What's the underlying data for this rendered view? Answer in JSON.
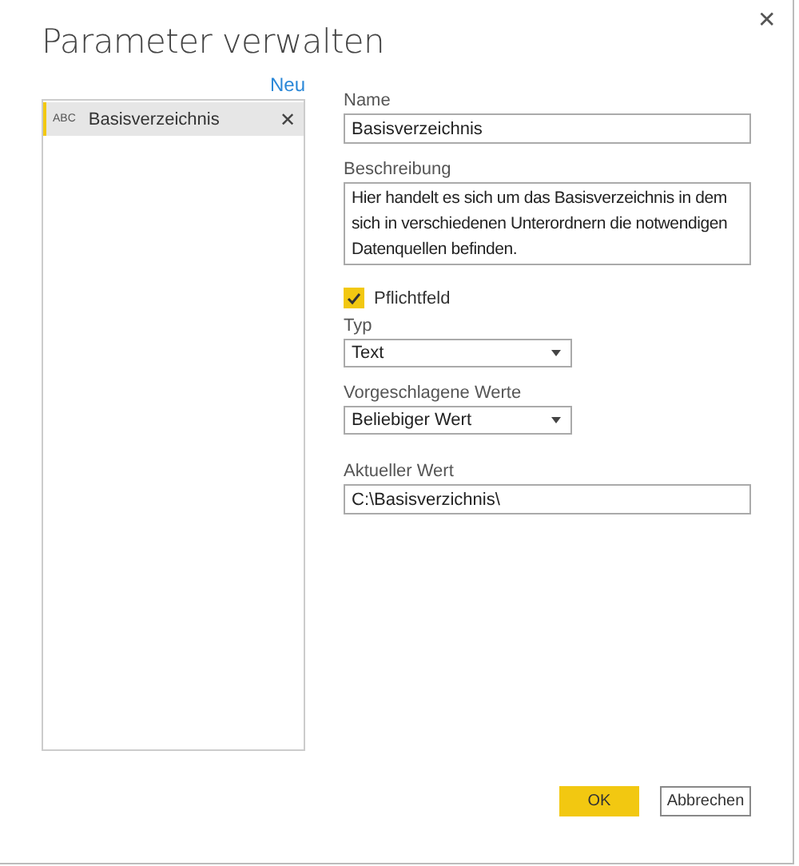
{
  "window": {
    "title": "Parameter verwalten",
    "close": "✕"
  },
  "parameters": {
    "new_link": "Neu",
    "items": [
      {
        "name": "Basisverzeichnis",
        "type_badge": "ABC",
        "selected": true,
        "remove": "✕"
      }
    ]
  },
  "form": {
    "name_label": "Name",
    "name_value": "Basisverzeichnis",
    "description_label": "Beschreibung",
    "description_value": "Hier handelt es sich um das Basisverzeichnis in dem sich in verschiedenen Unterordnern die notwendigen Datenquellen befinden.",
    "required": {
      "label": "Pflichtfeld",
      "checked": true
    },
    "type_label": "Typ",
    "type_value": "Text",
    "suggested_label": "Vorgeschlagene Werte",
    "suggested_value": "Beliebiger Wert",
    "current_label": "Aktueller Wert",
    "current_value": "C:\\Basisverzichnis\\"
  },
  "buttons": [
    {
      "label": "OK",
      "kind": "primary"
    },
    {
      "label": "Abbrechen",
      "kind": "secondary"
    }
  ]
}
